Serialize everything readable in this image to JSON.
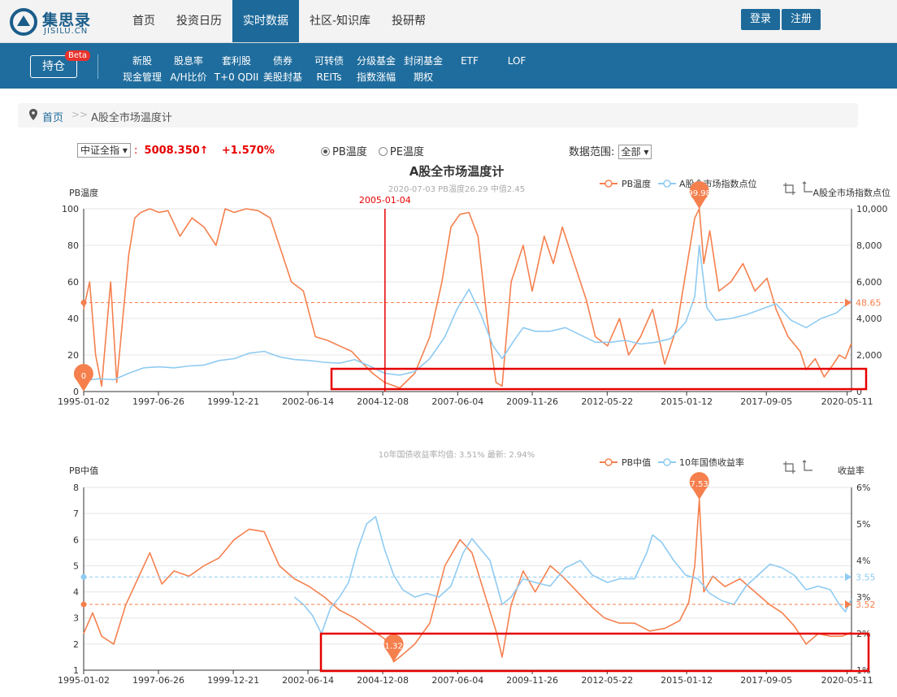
{
  "nav": {
    "logo_cn": "集思录",
    "logo_en": "JISILU.CN",
    "items": [
      "首页",
      "投资日历",
      "实时数据",
      "社区-知识库",
      "投研帮"
    ],
    "active_index": 2,
    "login": "登录",
    "register": "注册"
  },
  "subnav": {
    "hold": "持仓",
    "beta": "Beta",
    "row1": [
      "新股",
      "股息率",
      "套利股",
      "债券",
      "可转债",
      "分级基金",
      "封闭基金",
      "ETF",
      "LOF"
    ],
    "row2": [
      "现金管理",
      "A/H比价",
      "T+0 QDII",
      "美股封基",
      "REITs",
      "指数涨幅",
      "期权",
      "",
      ""
    ]
  },
  "breadcrumb": {
    "home": "首页",
    "sep": ">>",
    "current": "A股全市场温度计"
  },
  "controls": {
    "index_select": "中证全指",
    "index_value": "5008.350↑",
    "index_change": "+1.570%",
    "radio_pb": "PB温度",
    "radio_pe": "PE温度",
    "range_label": "数据范围:",
    "range_select": "全部"
  },
  "colors": {
    "orange": "#f5804e",
    "blue": "#8fcbf2",
    "red": "#e60000",
    "brand": "#1d6a9a"
  },
  "chart_data": [
    {
      "type": "line",
      "title": "A股全市场温度计",
      "subtitle": "2020-07-03 PB温度26.29 中值2.45",
      "ylabel": "PB温度",
      "y2label": "A股全市场指数点位",
      "x_ticks": [
        "1995-01-02",
        "1997-06-26",
        "1999-12-21",
        "2002-06-14",
        "2004-12-08",
        "2007-06-04",
        "2009-11-26",
        "2012-05-22",
        "2015-01-12",
        "2017-09-05",
        "2020-05-11"
      ],
      "x_range": [
        "1995-01-02",
        "2020-07-03"
      ],
      "ylim": [
        0,
        100
      ],
      "yticks": [
        0,
        20,
        40,
        60,
        80,
        100
      ],
      "y2lim": [
        0,
        10000
      ],
      "y2ticks": [
        "0",
        "2,000",
        "4,000",
        "6,000",
        "8,000",
        "10,000"
      ],
      "legend": [
        "PB温度",
        "A股全市场指数点位"
      ],
      "legend_position": "top-right",
      "series": [
        {
          "name": "PB温度",
          "color": "#f5804e",
          "x": [
            1995.0,
            1995.2,
            1995.4,
            1995.6,
            1995.9,
            1996.1,
            1996.3,
            1996.5,
            1996.7,
            1996.9,
            1997.2,
            1997.5,
            1997.8,
            1998.2,
            1998.6,
            1999.0,
            1999.4,
            1999.7,
            2000.0,
            2000.4,
            2000.8,
            2001.2,
            2001.6,
            2001.9,
            2002.3,
            2002.7,
            2003.1,
            2003.5,
            2003.9,
            2004.3,
            2004.6,
            2005.0,
            2005.5,
            2006.0,
            2006.5,
            2006.9,
            2007.2,
            2007.5,
            2007.8,
            2008.1,
            2008.4,
            2008.7,
            2008.9,
            2009.2,
            2009.6,
            2009.9,
            2010.3,
            2010.6,
            2010.9,
            2011.3,
            2011.7,
            2012.0,
            2012.4,
            2012.8,
            2013.1,
            2013.5,
            2013.9,
            2014.3,
            2014.7,
            2015.0,
            2015.3,
            2015.45,
            2015.6,
            2015.8,
            2016.1,
            2016.5,
            2016.9,
            2017.3,
            2017.7,
            2018.0,
            2018.4,
            2018.8,
            2019.0,
            2019.3,
            2019.6,
            2019.9,
            2020.1,
            2020.3,
            2020.5
          ],
          "values": [
            45,
            60,
            20,
            3,
            60,
            5,
            40,
            75,
            95,
            98,
            100,
            98,
            99,
            85,
            95,
            90,
            80,
            100,
            98,
            100,
            99,
            95,
            75,
            60,
            55,
            30,
            28,
            25,
            22,
            15,
            10,
            5,
            2,
            10,
            30,
            60,
            90,
            97,
            98,
            85,
            40,
            5,
            3,
            60,
            80,
            55,
            85,
            70,
            90,
            70,
            50,
            30,
            25,
            40,
            20,
            30,
            45,
            15,
            35,
            65,
            95,
            99.98,
            70,
            88,
            55,
            60,
            70,
            55,
            62,
            45,
            30,
            22,
            12,
            18,
            8,
            15,
            20,
            18,
            26.29
          ]
        },
        {
          "name": "A股全市场指数点位",
          "color": "#8fcbf2",
          "x": [
            1995.0,
            1995.5,
            1996.0,
            1996.5,
            1997.0,
            1997.5,
            1998.0,
            1998.5,
            1999.0,
            1999.5,
            2000.0,
            2000.5,
            2001.0,
            2001.5,
            2002.0,
            2002.5,
            2003.0,
            2003.5,
            2004.0,
            2004.5,
            2005.0,
            2005.5,
            2006.0,
            2006.5,
            2007.0,
            2007.4,
            2007.8,
            2008.2,
            2008.6,
            2008.9,
            2009.3,
            2009.6,
            2010.0,
            2010.5,
            2011.0,
            2011.5,
            2012.0,
            2012.5,
            2013.0,
            2013.5,
            2014.0,
            2014.5,
            2015.0,
            2015.3,
            2015.45,
            2015.7,
            2016.0,
            2016.5,
            2017.0,
            2017.5,
            2018.0,
            2018.5,
            2019.0,
            2019.5,
            2020.0,
            2020.5
          ],
          "values": [
            600,
            700,
            650,
            1000,
            1300,
            1350,
            1300,
            1400,
            1450,
            1700,
            1800,
            2100,
            2200,
            1900,
            1750,
            1700,
            1600,
            1550,
            1750,
            1400,
            1000,
            900,
            1100,
            1800,
            3000,
            4500,
            5600,
            4200,
            2500,
            1800,
            2800,
            3500,
            3300,
            3300,
            3500,
            3100,
            2700,
            2700,
            2800,
            2600,
            2700,
            2900,
            3800,
            5200,
            8000,
            4600,
            3900,
            4000,
            4200,
            4500,
            4800,
            3900,
            3500,
            4000,
            4300,
            5008
          ]
        }
      ],
      "markers": [
        {
          "label": "99.98",
          "series": "PB温度",
          "x": 2015.45,
          "y": 99.98
        },
        {
          "label": "0",
          "series": "PB温度",
          "x": 1995.0,
          "y": 0
        }
      ],
      "markline": {
        "label": "48.65",
        "value": 48.65
      },
      "vline": {
        "label": "2005-01-04",
        "x": 2005.01
      }
    },
    {
      "type": "line",
      "subtitle": "10年国债收益率均值: 3.51% 最新: 2.94%",
      "ylabel": "PB中值",
      "y2label": "收益率",
      "x_ticks": [
        "1995-01-02",
        "1997-06-26",
        "1999-12-21",
        "2002-06-14",
        "2004-12-08",
        "2007-06-04",
        "2009-11-26",
        "2012-05-22",
        "2015-01-12",
        "2017-09-05",
        "2020-05-11"
      ],
      "x_range": [
        "1995-01-02",
        "2020-07-03"
      ],
      "ylim": [
        1,
        8
      ],
      "yticks": [
        1,
        2,
        3,
        4,
        5,
        6,
        7,
        8
      ],
      "y2lim": [
        1,
        6
      ],
      "y2ticks": [
        "1%",
        "2%",
        "3%",
        "4%",
        "5%",
        "6%"
      ],
      "legend": [
        "PB中值",
        "10年国债收益率"
      ],
      "legend_position": "top-right",
      "series": [
        {
          "name": "PB中值",
          "color": "#f5804e",
          "x": [
            1995.0,
            1995.3,
            1995.6,
            1996.0,
            1996.4,
            1996.8,
            1997.2,
            1997.6,
            1998.0,
            1998.5,
            1999.0,
            1999.5,
            2000.0,
            2000.5,
            2001.0,
            2001.5,
            2002.0,
            2002.5,
            2003.0,
            2003.5,
            2004.0,
            2004.5,
            2005.0,
            2005.3,
            2005.6,
            2006.0,
            2006.5,
            2007.0,
            2007.5,
            2007.9,
            2008.3,
            2008.7,
            2008.9,
            2009.2,
            2009.6,
            2010.0,
            2010.5,
            2010.9,
            2011.4,
            2011.9,
            2012.3,
            2012.8,
            2013.3,
            2013.8,
            2014.3,
            2014.8,
            2015.1,
            2015.3,
            2015.45,
            2015.6,
            2015.9,
            2016.3,
            2016.8,
            2017.3,
            2017.8,
            2018.2,
            2018.6,
            2019.0,
            2019.4,
            2019.8,
            2020.2,
            2020.5
          ],
          "values": [
            2.4,
            3.2,
            2.3,
            2.0,
            3.5,
            4.5,
            5.5,
            4.3,
            4.8,
            4.6,
            5.0,
            5.3,
            6.0,
            6.4,
            6.3,
            5.0,
            4.5,
            4.2,
            3.8,
            3.3,
            3.0,
            2.6,
            2.2,
            1.32,
            1.6,
            2.0,
            2.8,
            5.0,
            6.0,
            5.5,
            4.0,
            2.5,
            1.5,
            3.5,
            4.8,
            4.0,
            5.0,
            4.6,
            4.0,
            3.4,
            3.0,
            2.8,
            2.8,
            2.5,
            2.6,
            2.9,
            3.6,
            5.0,
            7.53,
            4.0,
            4.6,
            4.2,
            4.5,
            4.0,
            3.5,
            3.2,
            2.7,
            2.0,
            2.4,
            2.3,
            2.3,
            2.45
          ]
        },
        {
          "name": "10年国债收益率",
          "color": "#8fcbf2",
          "x": [
            2002.0,
            2002.3,
            2002.6,
            2002.9,
            2003.2,
            2003.5,
            2003.8,
            2004.1,
            2004.4,
            2004.7,
            2005.0,
            2005.3,
            2005.6,
            2006.0,
            2006.4,
            2006.8,
            2007.2,
            2007.6,
            2007.9,
            2008.2,
            2008.5,
            2008.9,
            2009.2,
            2009.6,
            2010.0,
            2010.5,
            2011.0,
            2011.5,
            2011.9,
            2012.4,
            2012.8,
            2013.3,
            2013.7,
            2013.9,
            2014.2,
            2014.6,
            2015.0,
            2015.4,
            2015.8,
            2016.2,
            2016.6,
            2017.0,
            2017.4,
            2017.8,
            2018.2,
            2018.6,
            2019.0,
            2019.4,
            2019.8,
            2020.1,
            2020.3,
            2020.5
          ],
          "values": [
            3.0,
            2.8,
            2.5,
            2.0,
            2.7,
            3.0,
            3.4,
            4.3,
            5.0,
            5.2,
            4.3,
            3.6,
            3.2,
            3.0,
            3.1,
            3.0,
            3.3,
            4.2,
            4.6,
            4.3,
            4.0,
            2.8,
            3.0,
            3.5,
            3.4,
            3.3,
            3.8,
            4.0,
            3.6,
            3.4,
            3.5,
            3.5,
            4.2,
            4.7,
            4.5,
            4.0,
            3.6,
            3.5,
            3.1,
            2.9,
            2.8,
            3.3,
            3.6,
            3.9,
            3.8,
            3.6,
            3.2,
            3.3,
            3.2,
            2.8,
            2.6,
            2.94
          ]
        }
      ],
      "markers": [
        {
          "label": "7.53",
          "series": "PB中值",
          "x": 2015.45,
          "y": 7.53
        },
        {
          "label": "1.32",
          "series": "PB中值",
          "x": 2005.3,
          "y": 1.32
        }
      ],
      "marklines": [
        {
          "label": "3.55",
          "axis": "right",
          "value": 3.55,
          "color": "#8fcbf2"
        },
        {
          "label": "3.52",
          "axis": "left",
          "value": 3.52,
          "color": "#f5804e"
        }
      ]
    }
  ]
}
